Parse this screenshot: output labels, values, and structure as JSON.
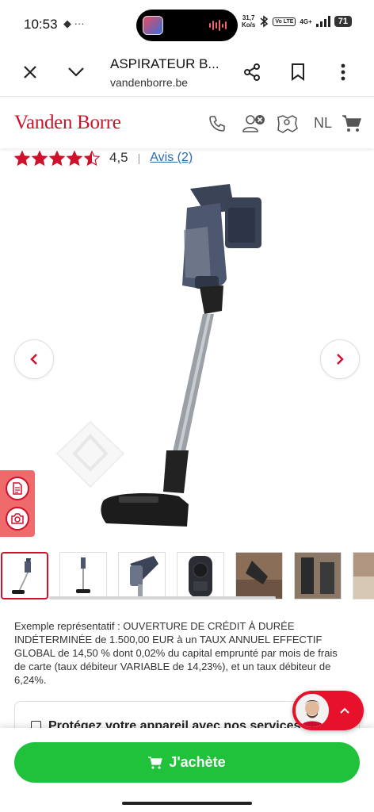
{
  "status_bar": {
    "time": "10:53",
    "left_icons": "◆ ···",
    "speed_value": "31,7",
    "speed_unit": "Ko/s",
    "volte": "Vo LTE",
    "network": "4G+",
    "battery": "71"
  },
  "browser": {
    "title": "ASPIRATEUR B...",
    "url": "vandenborre.be"
  },
  "site": {
    "logo": "Vanden Borre",
    "language": "NL",
    "brand_color": "#d0112b"
  },
  "rating": {
    "value": "4,5",
    "score": 4.5,
    "max": 5,
    "separator": "|",
    "reviews_link": "Avis (2)"
  },
  "credit_text": "Exemple représentatif : OUVERTURE DE CRÉDIT À DURÉE INDÉTERMINÉE de 1.500,00 EUR à un TAUX ANNUEL EFFECTIF GLOBAL de 14,50 % dont 0,02% du capital emprunté par mois de frais de carte (taux débiteur VARIABLE de 14,23%), et un taux débiteur de 6,24%.",
  "services": {
    "label": "Protégez votre appareil avec nos services"
  },
  "buy": {
    "label": "J'achète",
    "color": "#20c23b"
  },
  "icons": {
    "close": "close-icon",
    "chevron": "chevron-down-icon",
    "share": "share-icon",
    "bookmark": "bookmark-icon",
    "menu": "more-vertical-icon",
    "phone": "phone-icon",
    "account": "account-icon",
    "stores": "store-locator-icon",
    "cart": "cart-icon"
  }
}
